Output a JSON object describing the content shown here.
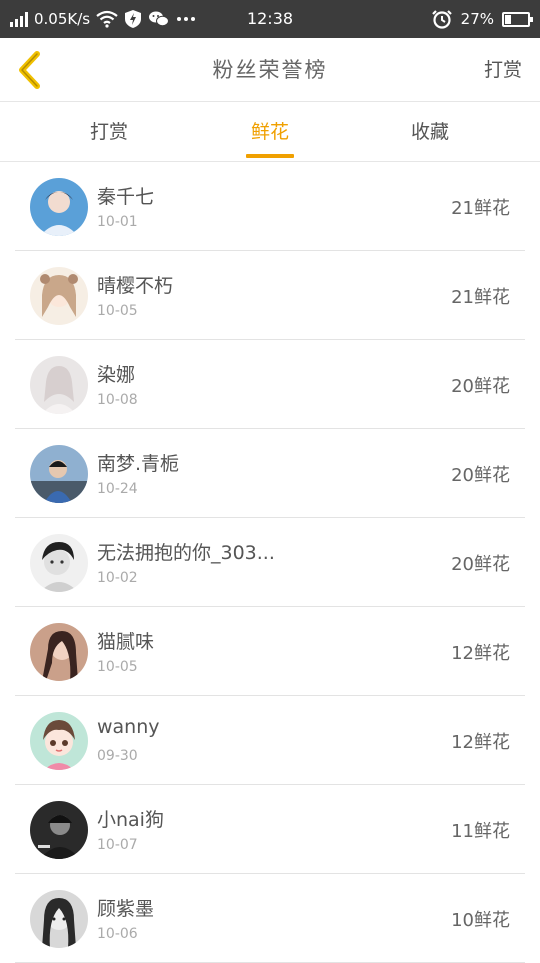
{
  "status_bar": {
    "speed": "0.05K/s",
    "time": "12:38",
    "battery": "27%",
    "battery_level": 0.27,
    "icons": [
      "signal-icon",
      "wifi-icon",
      "shield-bolt-icon",
      "wechat-icon",
      "more-dots-icon",
      "alarm-icon",
      "battery-icon"
    ]
  },
  "header": {
    "title": "粉丝荣誉榜",
    "action": "打赏",
    "back_icon": "chevron-left-icon"
  },
  "tabs": [
    {
      "label": "打赏",
      "active": false
    },
    {
      "label": "鲜花",
      "active": true
    },
    {
      "label": "收藏",
      "active": false
    }
  ],
  "colors": {
    "accent": "#f0a000",
    "status_bar_bg": "#3c3c3c",
    "text": "#555555",
    "subtext": "#aaaaaa"
  },
  "fans": [
    {
      "name": "秦千七",
      "date": "10-01",
      "flowers": "21鲜花"
    },
    {
      "name": "晴樱不朽",
      "date": "10-05",
      "flowers": "21鲜花"
    },
    {
      "name": "染娜",
      "date": "10-08",
      "flowers": "20鲜花"
    },
    {
      "name": "南梦.青栀",
      "date": "10-24",
      "flowers": "20鲜花"
    },
    {
      "name": "无法拥抱的你_303...",
      "date": "10-02",
      "flowers": "20鲜花"
    },
    {
      "name": "猫腻味",
      "date": "10-05",
      "flowers": "12鲜花"
    },
    {
      "name": "wanny",
      "date": "09-30",
      "flowers": "12鲜花"
    },
    {
      "name": "小nai狗",
      "date": "10-07",
      "flowers": "11鲜花"
    },
    {
      "name": "顾紫墨",
      "date": "10-06",
      "flowers": "10鲜花"
    }
  ]
}
